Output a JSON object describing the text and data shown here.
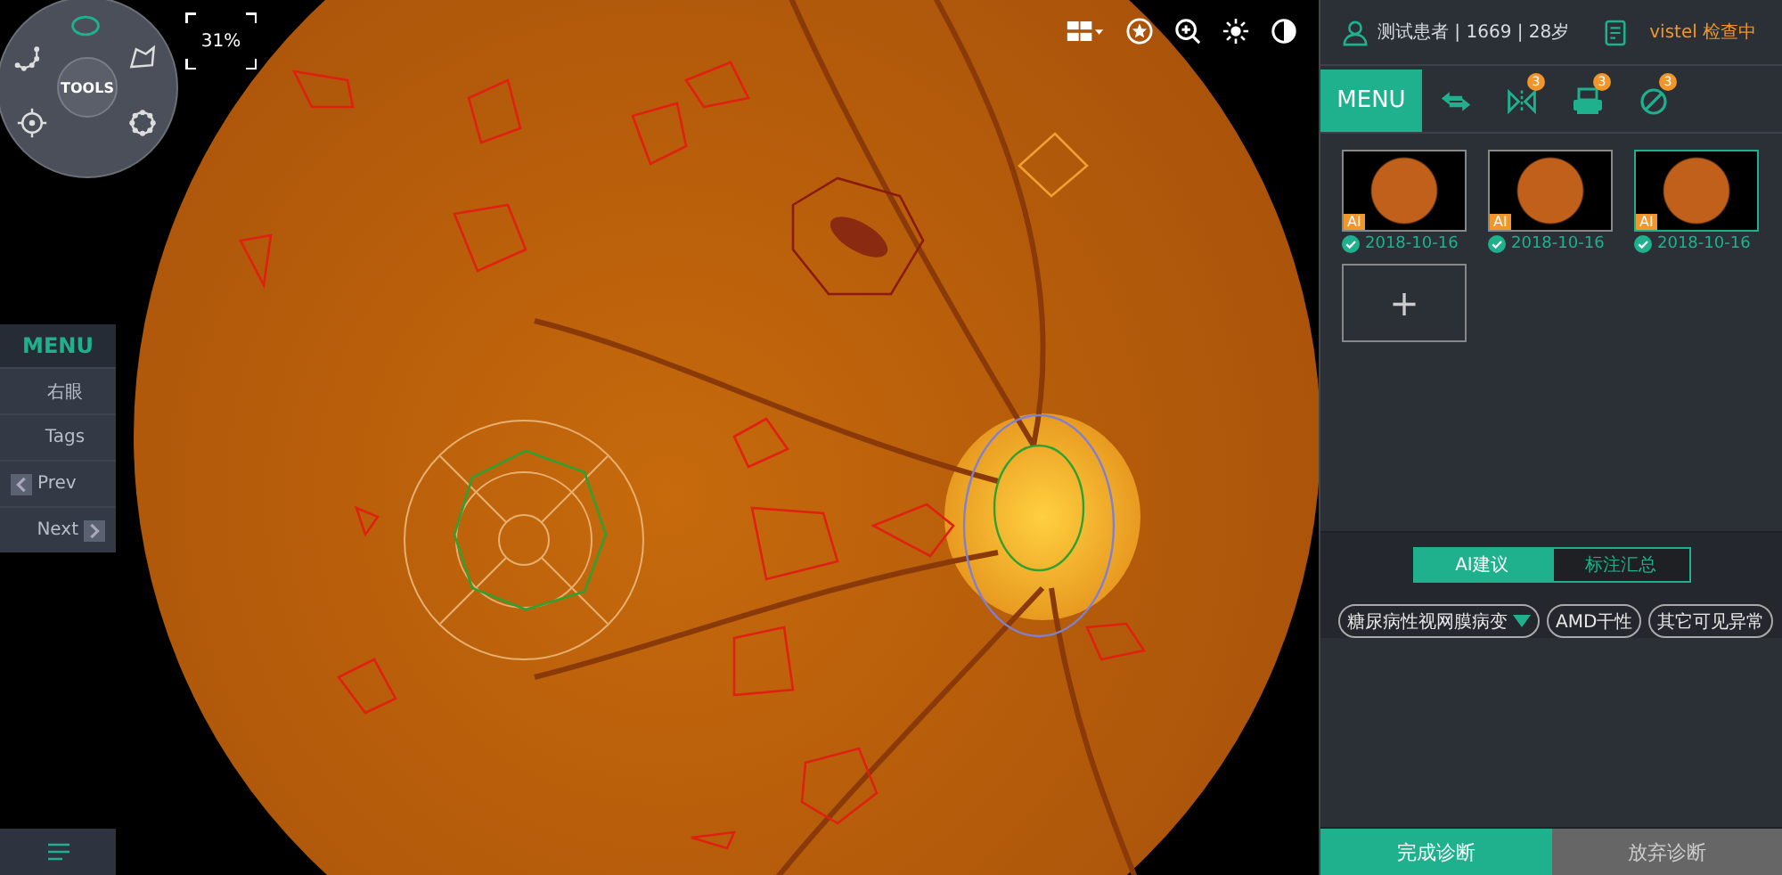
{
  "zoom": "31%",
  "tools": {
    "label": "TOOLS"
  },
  "side_menu": {
    "title": "MENU",
    "items": [
      {
        "label": "右眼",
        "kind": "plain"
      },
      {
        "label": "Tags",
        "kind": "plain"
      },
      {
        "label": "Prev",
        "kind": "prev"
      },
      {
        "label": "Next",
        "kind": "next"
      }
    ]
  },
  "patient": {
    "info": "测试患者 | 1669 | 28岁",
    "status": "vistel 检查中"
  },
  "menu": {
    "label": "MENU",
    "tools": [
      {
        "kind": "swap"
      },
      {
        "kind": "mirror",
        "badge": "3"
      },
      {
        "kind": "printer",
        "badge": "3"
      },
      {
        "kind": "ban",
        "badge": "3"
      }
    ]
  },
  "images": [
    {
      "ai": "AI",
      "date": "2018-10-16",
      "verified": true,
      "selected": false
    },
    {
      "ai": "AI",
      "date": "2018-10-16",
      "verified": true,
      "selected": false
    },
    {
      "ai": "AI",
      "date": "2018-10-16",
      "verified": true,
      "selected": true
    }
  ],
  "add_tile": "+",
  "tabs": [
    {
      "label": "AI建议",
      "selected": true
    },
    {
      "label": "标注汇总",
      "selected": false
    }
  ],
  "findings": [
    {
      "label": "糖尿病性视网膜病变",
      "kind": "dropdown"
    },
    {
      "label": "AMD干性",
      "kind": "plain"
    },
    {
      "label": "其它可见异常",
      "kind": "plain"
    }
  ],
  "actions": [
    {
      "label": "完成诊断",
      "kind": "primary"
    },
    {
      "label": "放弃诊断",
      "kind": "secondary"
    }
  ]
}
